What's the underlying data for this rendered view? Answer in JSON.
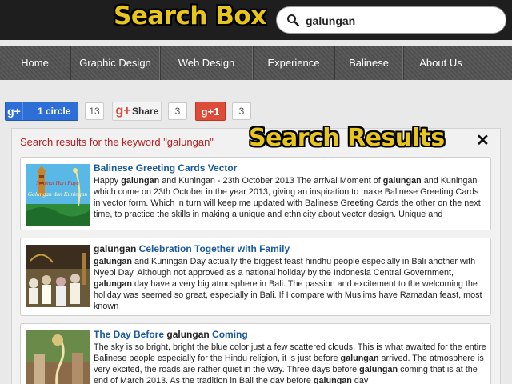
{
  "annotations": {
    "search_box": "Search Box",
    "search_results": "Search Results"
  },
  "search": {
    "value": "galungan",
    "icon": "search-icon"
  },
  "nav": {
    "items": [
      "Home",
      "Graphic Design",
      "Web Design",
      "Experience",
      "Balinese",
      "About Us"
    ]
  },
  "social": {
    "circle_label": "1 circle",
    "circle_count": "13",
    "share_label": "Share",
    "share_count": "3",
    "plus1_label": "g+1",
    "plus1_count": "3"
  },
  "results": {
    "heading": "Search results for the keyword \"galungan\"",
    "close_icon": "close-icon",
    "items": [
      {
        "title": "Balinese Greeting Cards Vector",
        "thumb_caption_1": "Selamat Hari Raya",
        "thumb_caption_2": "Galungan dan Kuningan",
        "body_html": "Happy <b>galungan</b> and Kuningan - 23th October 2013 The arrival Moment of <b>galungan</b> and Kuningan which come on 23th October in the year 2013, giving an inspiration to make Balinese Greeting Cards in vector form. Which in turn will keep me updated with Balinese Greeting Cards the other on the next time, to practice the skills in making a unique and ethnicity about vector design. Unique and"
      },
      {
        "title_keyword": "galungan",
        "title_rest": " Celebration Together with Family",
        "body_html": "<b>galungan</b> and Kuningan Day actually the biggest feast hindhu people especially in Bali another with Nyepi Day. Although not approved as a national holiday by the Indonesia Central Government, <b>galungan</b> day have a very big atmosphere in Bali. The passion and excitement to the welcoming the holiday was seemed so great, especially in Bali. If I compare with Muslims have Ramadan feast, most known"
      },
      {
        "title_start": "The Day Before ",
        "title_keyword": "galungan",
        "title_end": " Coming",
        "body_html": "The sky is so bright, bright the blue color just a few scattered clouds. This is what awaited for the entire Balinese people especially for the Hindu religion, it is just before <b>galungan</b> arrived. The atmosphere is very excited, the roads are rather quiet in the way. Three days before <b>galungan</b> coming that is at the end of March 2013. As the tradition in Bali the day before <b>galungan</b> day"
      }
    ]
  },
  "colors": {
    "accent_yellow": "#e8c51a",
    "heading_red": "#b22222",
    "link_blue": "#1a5a9a",
    "gplus_blue": "#2d6fd6",
    "gplus_red": "#dd4b39"
  }
}
